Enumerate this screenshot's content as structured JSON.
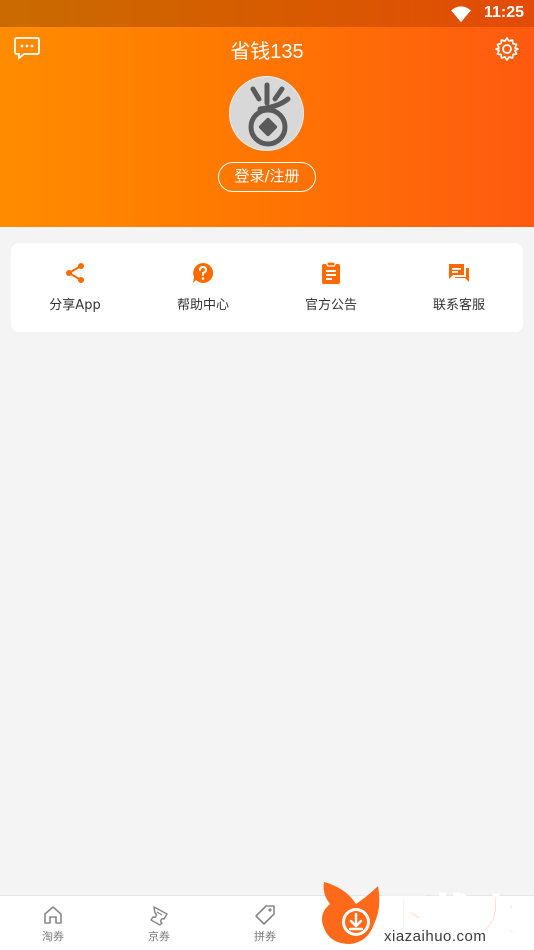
{
  "status_bar": {
    "time": "11:25",
    "wifi_icon": "wifi-icon"
  },
  "header": {
    "title": "省钱135",
    "message_icon": "message-icon",
    "settings_icon": "gear-icon",
    "avatar_icon": "avatar-coin-icon",
    "login_label": "登录/注册"
  },
  "quick_actions": [
    {
      "label": "分享App",
      "icon": "share-icon"
    },
    {
      "label": "帮助中心",
      "icon": "help-icon"
    },
    {
      "label": "官方公告",
      "icon": "clipboard-icon"
    },
    {
      "label": "联系客服",
      "icon": "chat-icon"
    }
  ],
  "bottom_nav": [
    {
      "label": "淘券",
      "icon": "home-icon"
    },
    {
      "label": "京券",
      "icon": "ticket-icon"
    },
    {
      "label": "拼券",
      "icon": "tag-icon"
    }
  ],
  "watermark": {
    "title": "下载火",
    "subtitle": "xiazaihuo.com"
  },
  "colors": {
    "accent": "#ff6a00",
    "header_start": "#ff8c00",
    "header_end": "#ff5a10"
  }
}
